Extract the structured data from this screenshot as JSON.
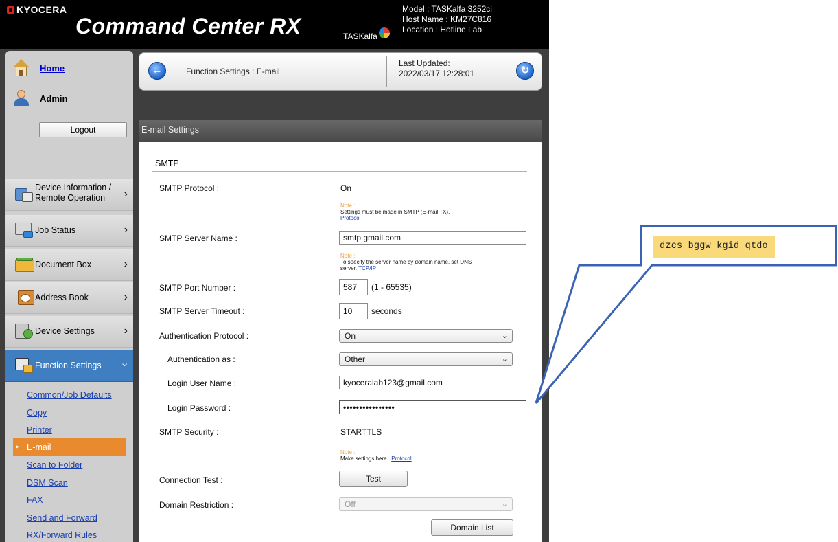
{
  "header": {
    "brand": "KYOCERA",
    "product_title": "Command Center RX",
    "product_sub": "TASKalfa",
    "device_info": {
      "model": "Model : TASKalfa 3252ci",
      "host": "Host Name : KM27C816",
      "location": "Location : Hotline Lab"
    }
  },
  "sidebar": {
    "home_label": "Home",
    "admin_label": "Admin",
    "logout_label": "Logout",
    "nav": [
      {
        "label_line1": "Device Information /",
        "label_line2": "Remote Operation",
        "icon": "device-information-icon"
      },
      {
        "label": "Job Status",
        "icon": "job-status-icon"
      },
      {
        "label": "Document Box",
        "icon": "document-box-icon"
      },
      {
        "label": "Address Book",
        "icon": "address-book-icon"
      },
      {
        "label": "Device Settings",
        "icon": "device-settings-icon"
      },
      {
        "label": "Function Settings",
        "icon": "function-settings-icon"
      }
    ],
    "sub_items": [
      "Common/Job Defaults",
      "Copy",
      "Printer",
      "E-mail",
      "Scan to Folder",
      "DSM Scan",
      "FAX",
      "Send and Forward",
      "RX/Forward Rules"
    ],
    "current_sub": "E-mail"
  },
  "topbar": {
    "breadcrumb": "Function Settings : E-mail",
    "last_updated_label": "Last Updated:",
    "last_updated_value": "2022/03/17 12:28:01"
  },
  "panel": {
    "title": "E-mail Settings",
    "section": "SMTP",
    "smtp_protocol_label": "SMTP Protocol :",
    "smtp_protocol_value": "On",
    "note_label": "Note :",
    "note1_text": "Settings must be made in SMTP (E-mail TX).",
    "note1_link": "Protocol",
    "server_name_label": "SMTP Server Name :",
    "server_name_value": "smtp.gmail.com",
    "note2_text_line1": "To specify the server name by domain name, set DNS",
    "note2_text_line2": "server.",
    "note2_link": "TCP/IP",
    "port_label": "SMTP Port Number :",
    "port_value": "587",
    "port_range": "(1 - 65535)",
    "timeout_label": "SMTP Server Timeout :",
    "timeout_value": "10",
    "timeout_unit": "seconds",
    "auth_protocol_label": "Authentication Protocol :",
    "auth_protocol_value": "On",
    "auth_as_label": "Authentication as :",
    "auth_as_value": "Other",
    "login_user_label": "Login User Name :",
    "login_user_value": "kyoceralab123@gmail.com",
    "login_pass_label": "Login Password :",
    "login_pass_value": "••••••••••••••••",
    "security_label": "SMTP Security :",
    "security_value": "STARTTLS",
    "note3_text": "Make settings here.",
    "note3_link": "Protocol",
    "conn_test_label": "Connection Test :",
    "test_button": "Test",
    "domain_restriction_label": "Domain Restriction :",
    "domain_restriction_value": "Off",
    "domain_list_button": "Domain List"
  },
  "callout": {
    "text": "dzcs bggw kgid qtdo",
    "fill_color": "#fad97a",
    "border_color": "#3b63b5"
  }
}
